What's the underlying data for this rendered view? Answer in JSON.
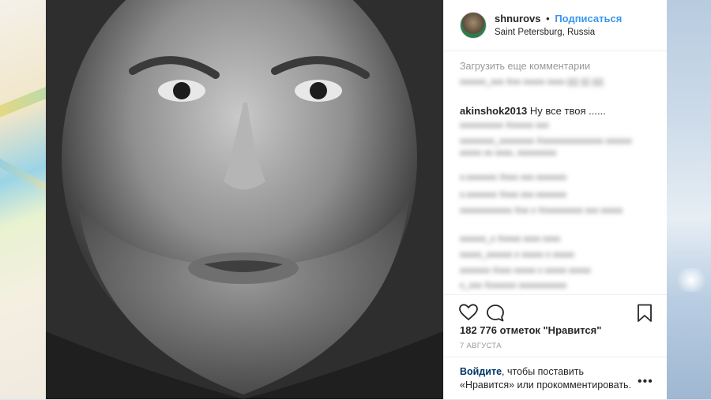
{
  "post": {
    "username": "shnurovs",
    "separator": "•",
    "follow_label": "Подписаться",
    "location": "Saint Petersburg, Russia"
  },
  "comments": {
    "load_more": "Загрузить еще комментарии",
    "visible_comment": {
      "username": "akinshok2013",
      "text": "Ну все твоя ......"
    }
  },
  "likes": {
    "count_text": "182 776 отметок \"Нравится\""
  },
  "date": "7 АВГУСТА",
  "login_prompt": {
    "link": "Войдите",
    "text": ", чтобы поставить «Нравится» или прокомментировать."
  },
  "icons": {
    "like": "heart-icon",
    "comment": "comment-bubble-icon",
    "save": "bookmark-icon",
    "more": "more-dots-icon"
  },
  "colors": {
    "link_blue": "#3897f0",
    "login_blue": "#003569",
    "muted_gray": "#999999",
    "text": "#262626"
  }
}
